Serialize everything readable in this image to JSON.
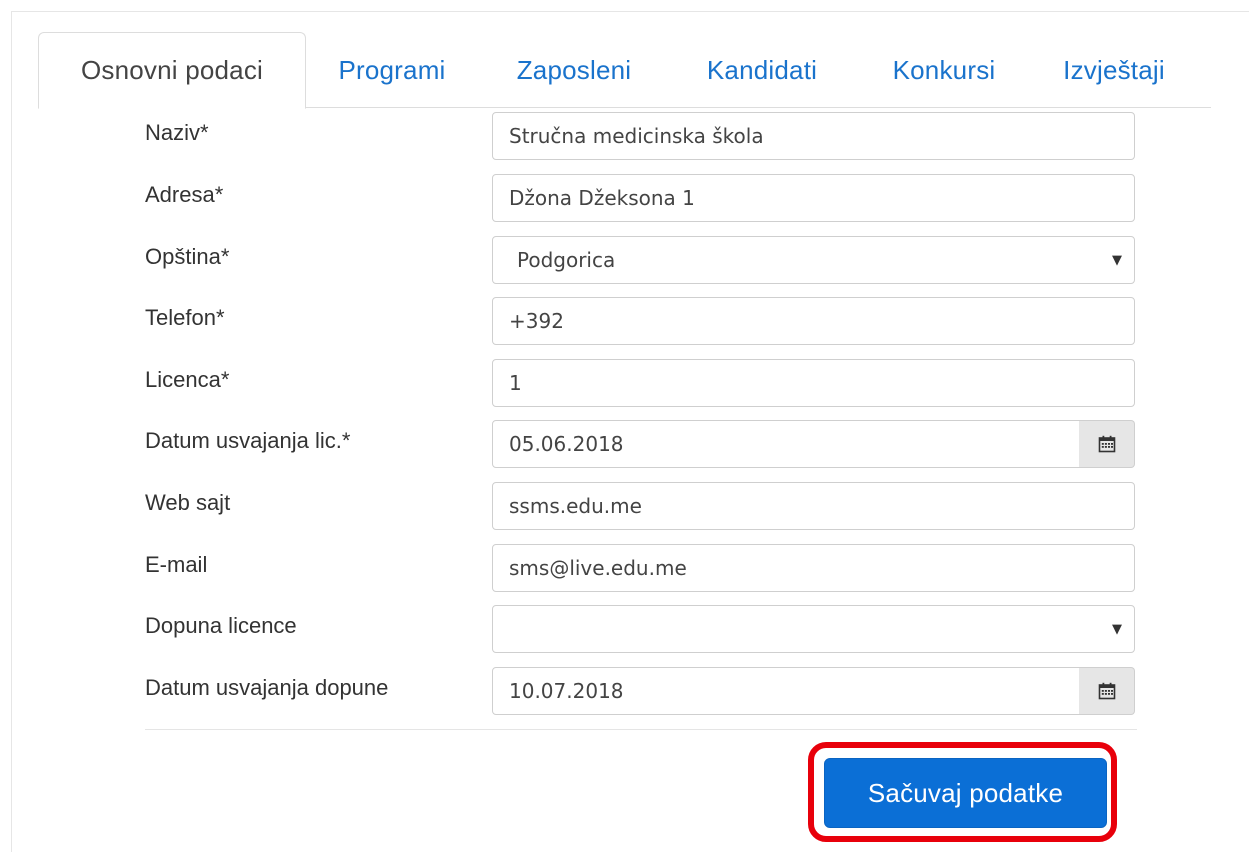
{
  "tabs": [
    {
      "label": "Osnovni podaci",
      "active": true
    },
    {
      "label": "Programi",
      "active": false
    },
    {
      "label": "Zaposleni",
      "active": false
    },
    {
      "label": "Kandidati",
      "active": false
    },
    {
      "label": "Konkursi",
      "active": false
    },
    {
      "label": "Izvještaji",
      "active": false
    }
  ],
  "form": {
    "naziv": {
      "label": "Naziv*",
      "value": "Stručna medicinska škola"
    },
    "adresa": {
      "label": "Adresa*",
      "value": "Džona Džeksona 1"
    },
    "opstina": {
      "label": "Opština*",
      "value": "Podgorica"
    },
    "telefon": {
      "label": "Telefon*",
      "value": "+392"
    },
    "licenca": {
      "label": "Licenca*",
      "value": "1"
    },
    "datum_licence": {
      "label": "Datum usvajanja lic.*",
      "value": "05.06.2018"
    },
    "web": {
      "label": "Web sajt",
      "value": "ssms.edu.me"
    },
    "email": {
      "label": "E-mail",
      "value": "sms@live.edu.me"
    },
    "dopuna": {
      "label": "Dopuna licence",
      "value": ""
    },
    "datum_dopune": {
      "label": "Datum usvajanja dopune",
      "value": "10.07.2018"
    }
  },
  "icons": {
    "calendar": "calendar-icon",
    "dropdown": "caret-down-icon"
  },
  "actions": {
    "save_label": "Sačuvaj podatke"
  },
  "colors": {
    "primary": "#0b6fd6",
    "link": "#1a73cc",
    "highlight": "#e8000b"
  }
}
